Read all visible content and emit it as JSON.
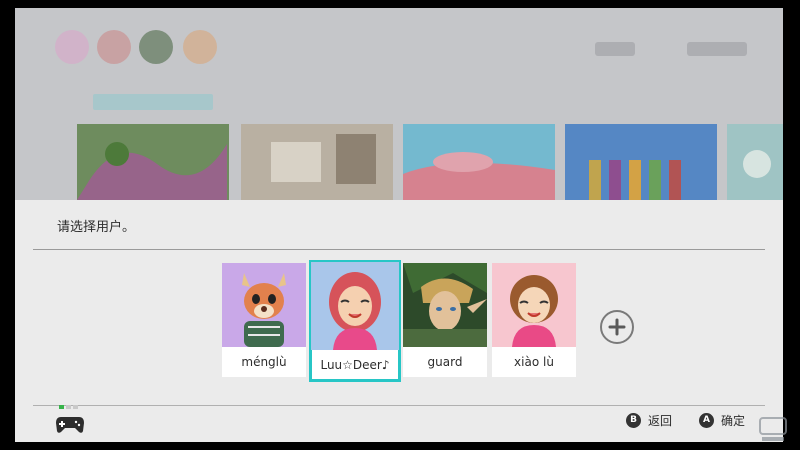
{
  "dialog": {
    "prompt": "请选择用户。"
  },
  "users": [
    {
      "name": "ménglù",
      "selected": false,
      "icon": "deer-villager-avatar"
    },
    {
      "name": "Luu☆Deer♪",
      "selected": true,
      "icon": "red-hair-mii-avatar"
    },
    {
      "name": "guard",
      "selected": false,
      "icon": "link-avatar"
    },
    {
      "name": "xiào lù",
      "selected": false,
      "icon": "brown-hair-mii-avatar"
    }
  ],
  "add_user": {
    "icon": "plus-icon"
  },
  "footer": {
    "back": {
      "glyph": "B",
      "label": "返回"
    },
    "confirm": {
      "glyph": "A",
      "label": "确定"
    }
  },
  "colors": {
    "selection": "#27c6c6",
    "dialog_bg": "#ebebeb",
    "background_dim": "#c5c6c9"
  }
}
